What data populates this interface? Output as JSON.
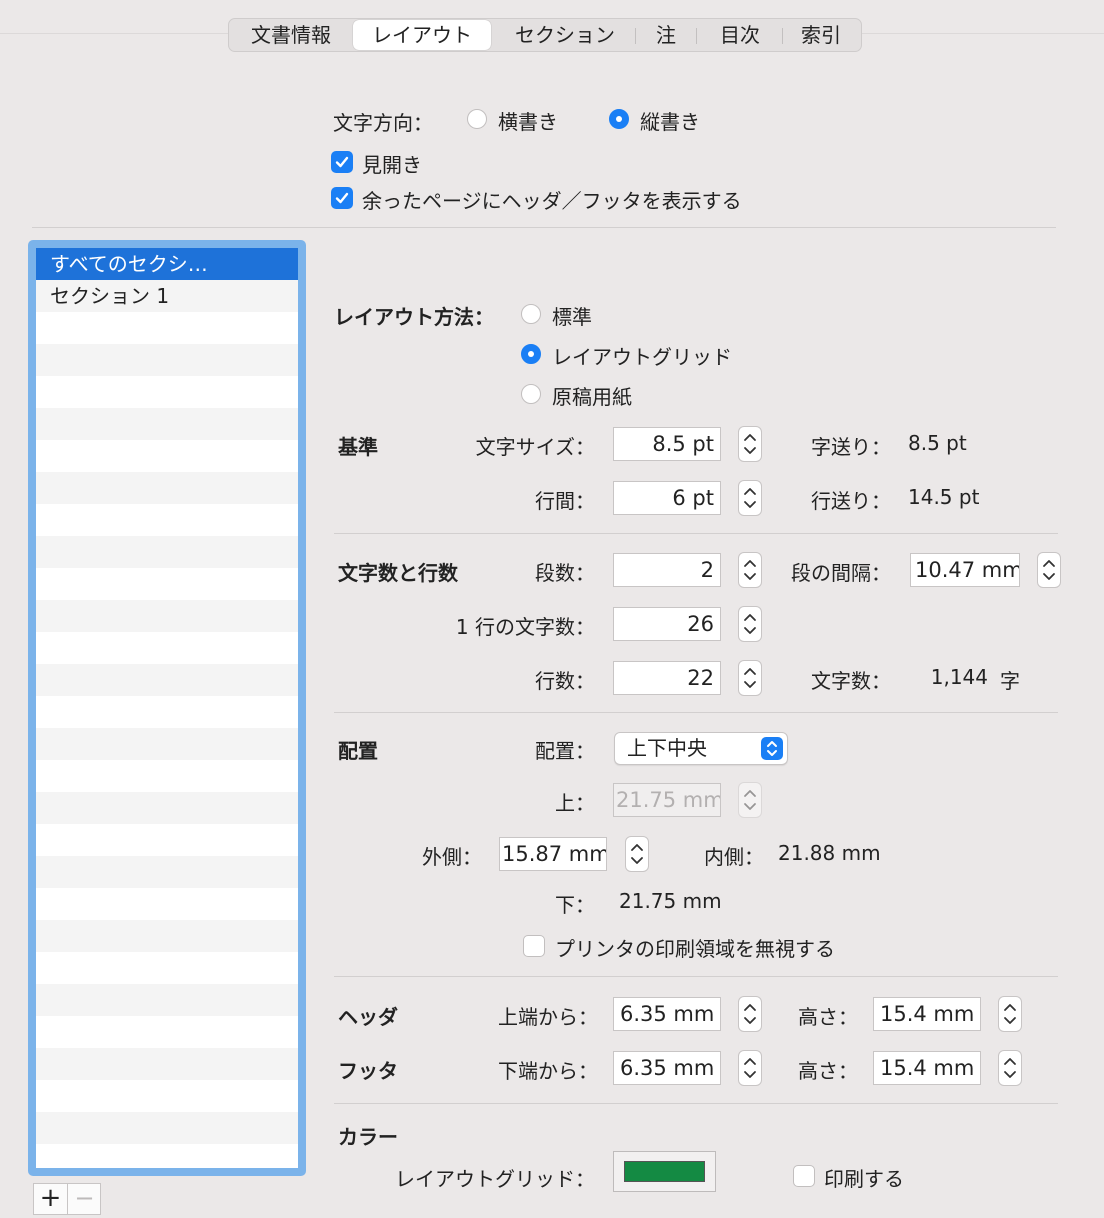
{
  "tabs": [
    {
      "label": "文書情報"
    },
    {
      "label": "レイアウト",
      "selected": true
    },
    {
      "label": "セクション"
    },
    {
      "label": "注"
    },
    {
      "label": "目次"
    },
    {
      "label": "索引"
    }
  ],
  "direction": {
    "label": "文字方向：",
    "options": [
      "横書き",
      "縦書き"
    ],
    "selected": "縦書き"
  },
  "checks": {
    "spread": {
      "label": "見開き",
      "checked": true
    },
    "header_footer": {
      "label": "余ったページにヘッダ／フッタを表示する",
      "checked": true
    }
  },
  "sections": {
    "items": [
      "すべてのセクシ…",
      "セクション 1"
    ],
    "selected_index": 0,
    "add": "+",
    "remove": "−"
  },
  "layout_method": {
    "label": "レイアウト方法：",
    "options": [
      "標準",
      "レイアウトグリッド",
      "原稿用紙"
    ],
    "selected": "レイアウトグリッド"
  },
  "basis": {
    "title": "基準",
    "font_size_label": "文字サイズ：",
    "font_size": "8.5 pt",
    "char_spacing_label": "字送り：",
    "char_spacing": "8.5 pt",
    "line_gap_label": "行間：",
    "line_gap": "6 pt",
    "line_feed_label": "行送り：",
    "line_feed": "14.5 pt"
  },
  "counts": {
    "title": "文字数と行数",
    "columns_label": "段数：",
    "columns": "2",
    "column_gap_label": "段の間隔：",
    "column_gap": "10.47 mm",
    "chars_per_line_label": "1 行の文字数：",
    "chars_per_line": "26",
    "lines_label": "行数：",
    "lines": "22",
    "total_label": "文字数：",
    "total": "1,144",
    "total_unit": "字"
  },
  "placement": {
    "title": "配置",
    "align_label": "配置：",
    "align_value": "上下中央",
    "top_label": "上：",
    "top": "21.75 mm",
    "outer_label": "外側：",
    "outer": "15.87 mm",
    "inner_label": "内側：",
    "inner": "21.88 mm",
    "bottom_label": "下：",
    "bottom": "21.75 mm",
    "ignore_printer": {
      "label": "プリンタの印刷領域を無視する",
      "checked": false
    }
  },
  "header": {
    "title": "ヘッダ",
    "from_label": "上端から：",
    "from": "6.35 mm",
    "height_label": "高さ：",
    "height": "15.4 mm"
  },
  "footer": {
    "title": "フッタ",
    "from_label": "下端から：",
    "from": "6.35 mm",
    "height_label": "高さ：",
    "height": "15.4 mm"
  },
  "color": {
    "title": "カラー",
    "grid_label": "レイアウトグリッド：",
    "grid_color": "#148a43",
    "print": {
      "label": "印刷する",
      "checked": false
    }
  },
  "accent": "#1a7ff5"
}
